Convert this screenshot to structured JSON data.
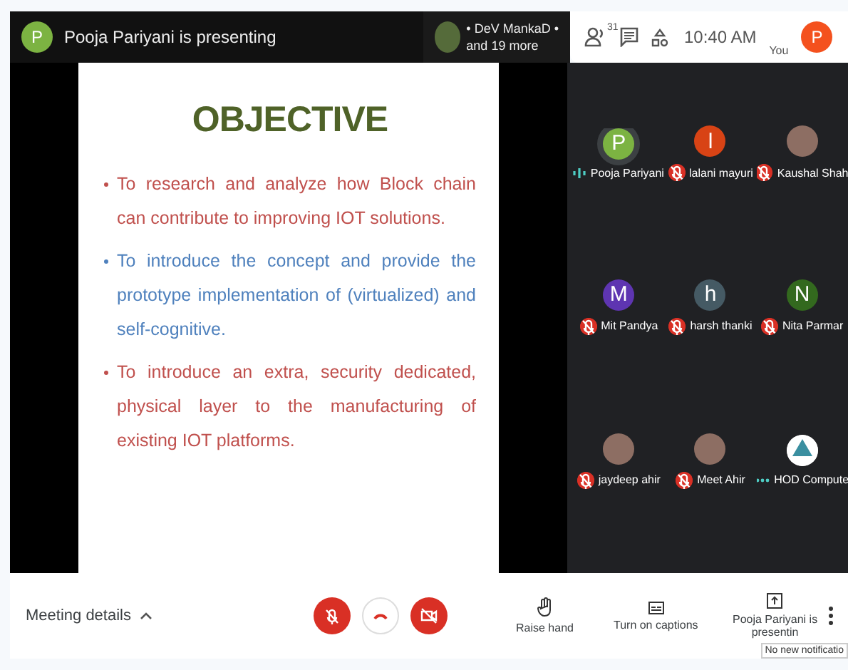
{
  "top_bar": {
    "presenter_initial": "P",
    "presenter_text": "Pooja Pariyani is presenting",
    "chip_line_1": "• DeV MankaD •",
    "chip_line_2": "and 19 more",
    "people_count": "31",
    "time": "10:40 AM",
    "you_label": "You",
    "you_initial": "P"
  },
  "slide": {
    "title": "OBJECTIVE",
    "bullets": [
      {
        "text": "To research and analyze how Block chain can contribute to improving IOT solutions.",
        "color": "#c0504d"
      },
      {
        "text": "To introduce the concept and provide the prototype implementation of (virtualized) and self-cognitive.",
        "color": "#4f81bd"
      },
      {
        "text": "To introduce an extra, security dedicated, physical layer to the manufacturing of existing IOT platforms.",
        "color": "#c0504d"
      }
    ]
  },
  "participants": [
    {
      "name": "Pooja Pariyani",
      "kind": "letter",
      "initial": "P",
      "color": "#7cb342",
      "muted": false,
      "speaking": true
    },
    {
      "name": "lalani mayuri",
      "kind": "letter",
      "initial": "l",
      "color": "#d84315",
      "muted": true,
      "speaking": false
    },
    {
      "name": "Kaushal Shah",
      "kind": "photo",
      "muted": true,
      "speaking": false
    },
    {
      "name": "Mit Pandya",
      "kind": "letter",
      "initial": "M",
      "color": "#5e35b1",
      "muted": true,
      "speaking": false
    },
    {
      "name": "harsh thanki",
      "kind": "letter",
      "initial": "h",
      "color": "#455a64",
      "muted": true,
      "speaking": false
    },
    {
      "name": "Nita Parmar",
      "kind": "letter",
      "initial": "N",
      "color": "#33691e",
      "muted": true,
      "speaking": false
    },
    {
      "name": "jaydeep ahir",
      "kind": "photo",
      "muted": true,
      "speaking": false
    },
    {
      "name": "Meet Ahir",
      "kind": "photo",
      "muted": true,
      "speaking": false
    },
    {
      "name": "HOD Compute",
      "kind": "logo",
      "muted": false,
      "speaking": false
    }
  ],
  "bottom_bar": {
    "meeting_details": "Meeting details",
    "raise_hand": "Raise hand",
    "captions": "Turn on captions",
    "presenting": "Pooja Pariyani is presentin",
    "tooltip": "No new notificatio"
  }
}
